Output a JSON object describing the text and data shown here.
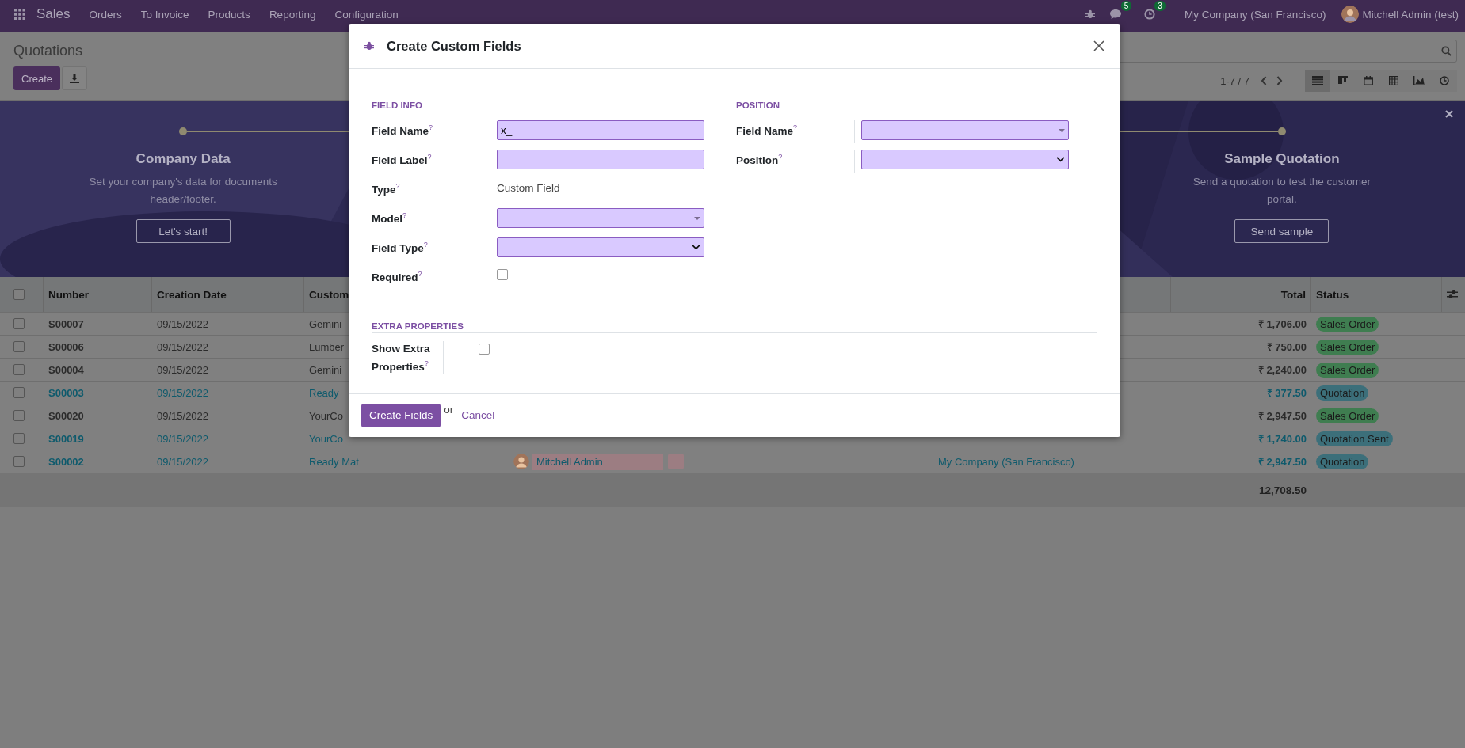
{
  "navbar": {
    "app": "Sales",
    "menu": [
      "Orders",
      "To Invoice",
      "Products",
      "Reporting",
      "Configuration"
    ],
    "messages_count": "5",
    "activities_count": "3",
    "company": "My Company (San Francisco)",
    "user": "Mitchell Admin (test)"
  },
  "control_panel": {
    "title": "Quotations",
    "create": "Create",
    "pager": "1-7 / 7",
    "views": [
      {
        "kind": "list",
        "selected": true
      },
      {
        "kind": "kanban",
        "selected": false
      },
      {
        "kind": "calendar",
        "selected": false
      },
      {
        "kind": "pivot",
        "selected": false
      },
      {
        "kind": "graph",
        "selected": false
      },
      {
        "kind": "activity",
        "selected": false
      }
    ]
  },
  "onboarding": {
    "first_step": {
      "title": "Company Data",
      "description": "Set your company's data for documents header/footer.",
      "button": "Let's start!"
    },
    "last_step": {
      "title": "Sample Quotation",
      "description": "Send a quotation to test the customer portal.",
      "button": "Send sample"
    }
  },
  "table": {
    "select_all_checked": false,
    "columns": [
      "Number",
      "Creation Date",
      "Custom",
      "Total",
      "Status"
    ],
    "rows": [
      {
        "number": "S00007",
        "date": "09/15/2022",
        "customer": "Gemini",
        "total": "₹ 1,706.00",
        "status": "Sales Order",
        "color": "#3f7d50",
        "highlight": false,
        "checked": false
      },
      {
        "number": "S00006",
        "date": "09/15/2022",
        "customer": "Lumber",
        "total": "₹ 750.00",
        "status": "Sales Order",
        "color": "#3f7d50",
        "highlight": false,
        "checked": false
      },
      {
        "number": "S00004",
        "date": "09/15/2022",
        "customer": "Gemini",
        "total": "₹ 2,240.00",
        "status": "Sales Order",
        "color": "#3f7d50",
        "highlight": false,
        "checked": false
      },
      {
        "number": "S00003",
        "date": "09/15/2022",
        "customer": "Ready",
        "total": "₹ 377.50",
        "status": "Quotation",
        "color": "#3c6f7a",
        "highlight": true,
        "checked": false
      },
      {
        "number": "S00020",
        "date": "09/15/2022",
        "customer": "YourCo",
        "total": "₹ 2,947.50",
        "status": "Sales Order",
        "color": "#3f7d50",
        "highlight": false,
        "checked": false
      },
      {
        "number": "S00019",
        "date": "09/15/2022",
        "customer": "YourCo",
        "total": "₹ 1,740.00",
        "status": "Quotation Sent",
        "color": "#3c6f7a",
        "highlight": true,
        "checked": false
      },
      {
        "number": "S00002",
        "date": "09/15/2022",
        "customer": "Ready Mat",
        "salesperson": "Mitchell Admin",
        "company": "My Company (San Francisco)",
        "total": "₹ 2,947.50",
        "status": "Quotation",
        "color": "#3c6f7a",
        "highlight": true,
        "checked": false
      }
    ],
    "footer_total": "12,708.50"
  },
  "dialog": {
    "title": "Create Custom Fields",
    "groups": [
      {
        "heading": "FIELD INFO",
        "fields": [
          {
            "label": "Field Name$^{?}$",
            "kind": "input",
            "value": "x_"
          },
          {
            "label": "Field Label$^{?}$",
            "kind": "input"
          },
          {
            "label": "Type$^{?}$",
            "kind": "text",
            "value": "Custom Field"
          },
          {
            "label": "Model$^{?}$",
            "kind": "many2one"
          },
          {
            "label": "Field Type$^{?}$",
            "kind": "select"
          },
          {
            "label": "Required$^{?}$",
            "kind": "checkbox",
            "checked": false
          }
        ]
      },
      {
        "heading": "POSITION",
        "fields": [
          {
            "label": "Field Name$^{?}$",
            "kind": "many2one"
          },
          {
            "label": "Position$^{?}$",
            "kind": "select"
          }
        ]
      }
    ],
    "extra": {
      "heading": "EXTRA PROPERTIES",
      "fields": [
        {
          "label": "Show Extra Properties$^{?}$",
          "kind": "checkbox",
          "checked": false
        }
      ]
    },
    "primary_button": "Create Fields",
    "or": "or",
    "cancel": "Cancel"
  }
}
